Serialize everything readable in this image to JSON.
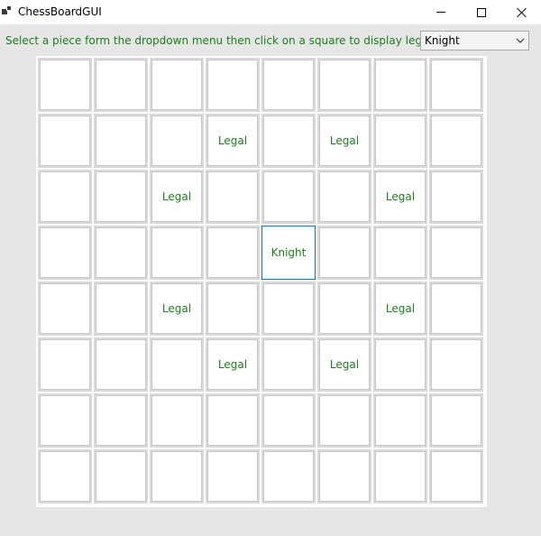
{
  "window": {
    "title": "ChessBoardGUI"
  },
  "instruction_text": "Select a piece form the dropdown menu then click on a square to display legal moves",
  "piece_dropdown": {
    "selected": "Knight"
  },
  "colors": {
    "label_text": "#1a7f1a",
    "selected_border": "#0078d7"
  },
  "board": {
    "rows": [
      [
        "",
        "",
        "",
        "",
        "",
        "",
        "",
        ""
      ],
      [
        "",
        "",
        "",
        "Legal",
        "",
        "Legal",
        "",
        ""
      ],
      [
        "",
        "",
        "Legal",
        "",
        "",
        "",
        "Legal",
        ""
      ],
      [
        "",
        "",
        "",
        "",
        "Knight",
        "",
        "",
        ""
      ],
      [
        "",
        "",
        "Legal",
        "",
        "",
        "",
        "Legal",
        ""
      ],
      [
        "",
        "",
        "",
        "Legal",
        "",
        "Legal",
        "",
        ""
      ],
      [
        "",
        "",
        "",
        "",
        "",
        "",
        "",
        ""
      ],
      [
        "",
        "",
        "",
        "",
        "",
        "",
        "",
        ""
      ]
    ],
    "selected_square": [
      3,
      4
    ]
  }
}
